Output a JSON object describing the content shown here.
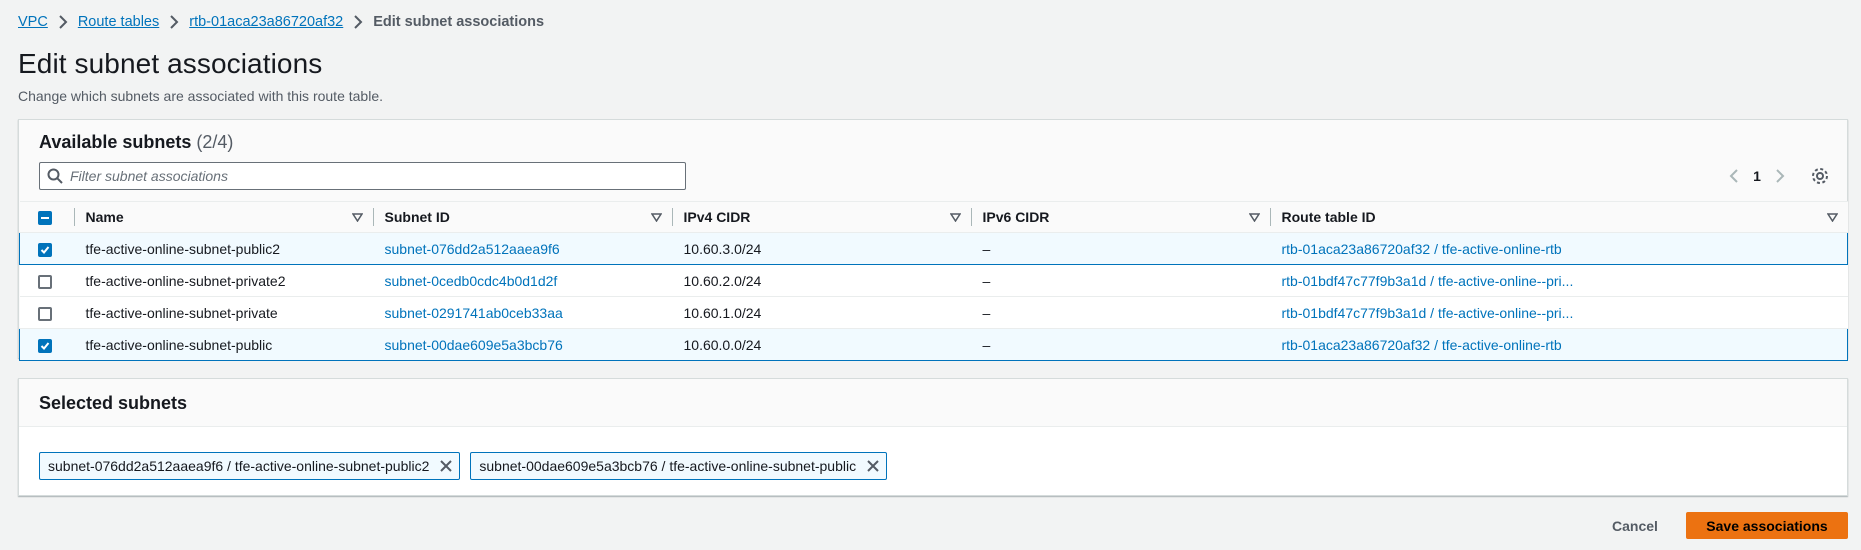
{
  "breadcrumb": {
    "items": [
      {
        "label": "VPC"
      },
      {
        "label": "Route tables"
      },
      {
        "label": "rtb-01aca23a86720af32"
      }
    ],
    "current": "Edit subnet associations"
  },
  "page": {
    "title": "Edit subnet associations",
    "description": "Change which subnets are associated with this route table."
  },
  "available": {
    "title": "Available subnets",
    "count": "(2/4)",
    "filter_placeholder": "Filter subnet associations",
    "page_number": "1",
    "columns": [
      "Name",
      "Subnet ID",
      "IPv4 CIDR",
      "IPv6 CIDR",
      "Route table ID"
    ],
    "rows": [
      {
        "selected": true,
        "name": "tfe-active-online-subnet-public2",
        "subnet_id": "subnet-076dd2a512aaea9f6",
        "ipv4": "10.60.3.0/24",
        "ipv6": "–",
        "route_table": "rtb-01aca23a86720af32 / tfe-active-online-rtb"
      },
      {
        "selected": false,
        "name": "tfe-active-online-subnet-private2",
        "subnet_id": "subnet-0cedb0cdc4b0d1d2f",
        "ipv4": "10.60.2.0/24",
        "ipv6": "–",
        "route_table": "rtb-01bdf47c77f9b3a1d / tfe-active-online--pri..."
      },
      {
        "selected": false,
        "name": "tfe-active-online-subnet-private",
        "subnet_id": "subnet-0291741ab0ceb33aa",
        "ipv4": "10.60.1.0/24",
        "ipv6": "–",
        "route_table": "rtb-01bdf47c77f9b3a1d / tfe-active-online--pri..."
      },
      {
        "selected": true,
        "name": "tfe-active-online-subnet-public",
        "subnet_id": "subnet-00dae609e5a3bcb76",
        "ipv4": "10.60.0.0/24",
        "ipv6": "–",
        "route_table": "rtb-01aca23a86720af32 / tfe-active-online-rtb"
      }
    ]
  },
  "selected": {
    "title": "Selected subnets",
    "tokens": [
      "subnet-076dd2a512aaea9f6 / tfe-active-online-subnet-public2",
      "subnet-00dae609e5a3bcb76 / tfe-active-online-subnet-public"
    ]
  },
  "actions": {
    "cancel": "Cancel",
    "save": "Save associations"
  },
  "colors": {
    "link": "#0073bb",
    "primary_button": "#ec7211",
    "selected_row_bg": "#f1faff"
  }
}
